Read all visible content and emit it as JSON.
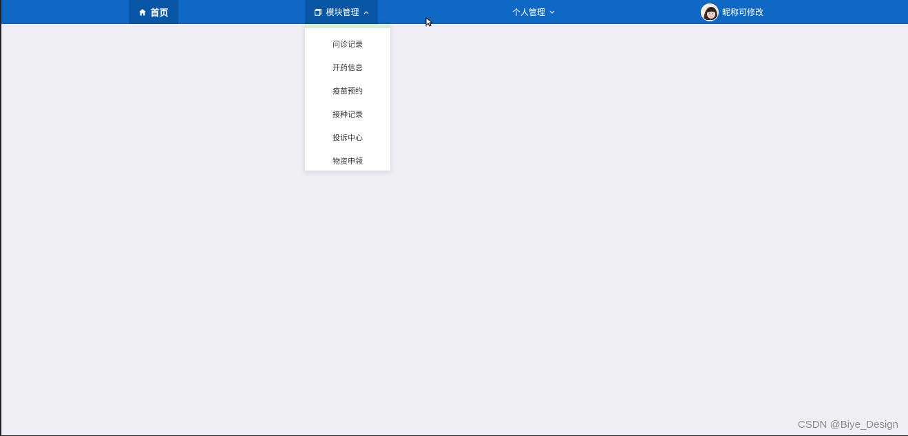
{
  "topbar": {
    "home_label": "首页",
    "module_label": "模块管理",
    "personal_label": "个人管理",
    "user_name": "昵称可修改",
    "colors": {
      "bar": "#0f68c4",
      "active": "#0a56a6",
      "text": "#ffffff"
    },
    "icons": {
      "home": "home-icon",
      "module": "copy-icon",
      "personal_caret": "chevron-down-icon",
      "module_caret": "chevron-up-icon"
    }
  },
  "dropdown": {
    "items": [
      {
        "label": "问诊记录"
      },
      {
        "label": "开药信息"
      },
      {
        "label": "疫苗预约"
      },
      {
        "label": "接种记录"
      },
      {
        "label": "投诉中心"
      },
      {
        "label": "物资申领"
      }
    ],
    "accent": "#d7efd7"
  },
  "watermark": {
    "text": "CSDN @Biye_Design"
  }
}
